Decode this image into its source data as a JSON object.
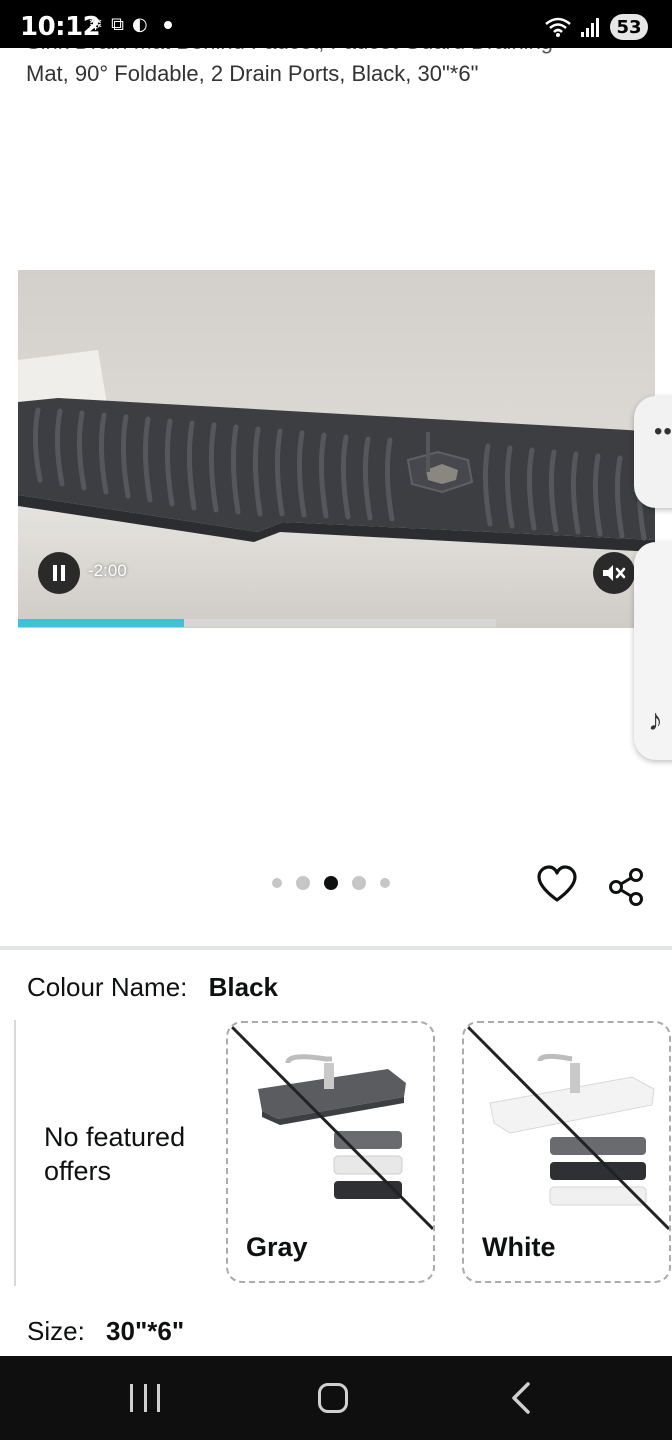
{
  "status_bar": {
    "time": "10:12",
    "battery": "53",
    "icons_left": [
      "snowflake-icon",
      "screenshot-icon",
      "link-icon",
      "dot-icon"
    ],
    "icons_right": [
      "wifi-icon",
      "signal-icon",
      "battery-icon"
    ]
  },
  "product": {
    "title_line1": "Sink Drain Mat Behind Faucet, Faucet Guard Draining",
    "title_line2": "Mat, 90° Foldable, 2 Drain Ports, Black, 30\"*6\""
  },
  "video": {
    "time_remaining": "-2:00",
    "progress": 0.26,
    "buffered": 0.75,
    "state": "playing",
    "muted": true
  },
  "carousel": {
    "count": 5,
    "active_index": 2
  },
  "colour": {
    "label": "Colour Name:",
    "selected": "Black",
    "no_offers_text": "No featured offers",
    "options": [
      {
        "name": "Gray",
        "unavailable": true
      },
      {
        "name": "White",
        "unavailable": true
      }
    ]
  },
  "size": {
    "label": "Size:",
    "selected": "30\"*6\""
  },
  "colors": {
    "progress": "#3ec2d8",
    "mat_dark": "#3d3e42",
    "status_bar_bg": "#000000",
    "nav_bar_bg": "#0f0f0f"
  },
  "nav_bar": {
    "buttons": [
      "recents-icon",
      "home-icon",
      "back-icon"
    ]
  }
}
